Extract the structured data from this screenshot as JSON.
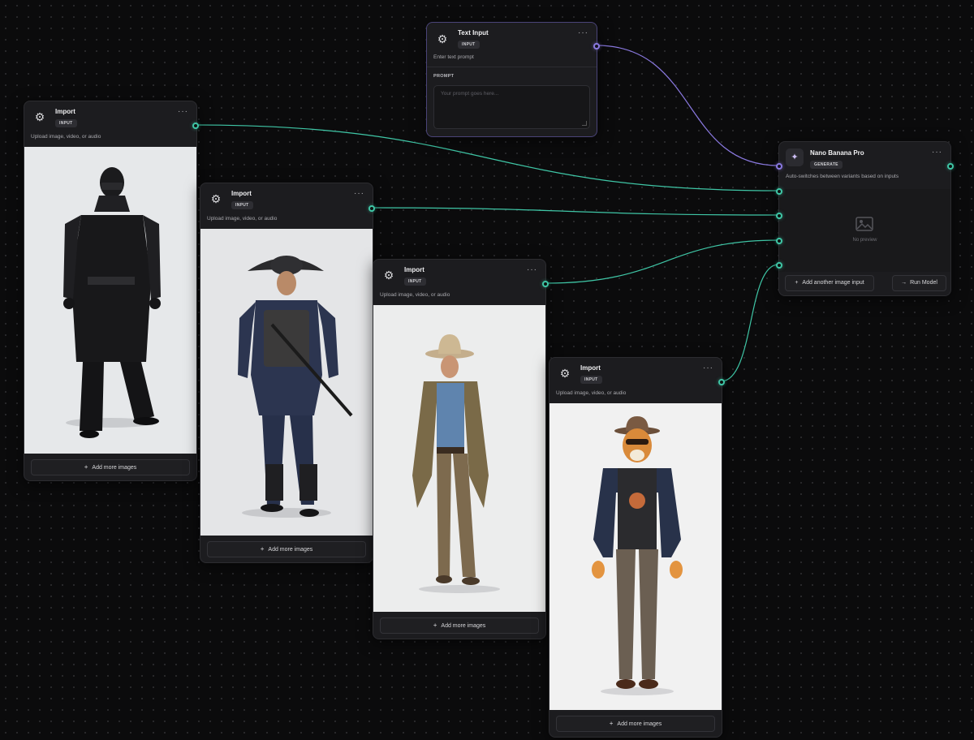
{
  "colors": {
    "canvas": "#0b0b0c",
    "node_bg": "#1c1c1f",
    "teal_wire": "#3fc6a6",
    "purple_wire": "#8a79e0"
  },
  "text_input": {
    "title": "Text Input",
    "badge": "INPUT",
    "description": "Enter text prompt",
    "section_label": "PROMPT",
    "placeholder": "Your prompt goes here...",
    "icon": "gear-icon"
  },
  "nano": {
    "title": "Nano Banana Pro",
    "badge": "GENERATE",
    "description": "Auto-switches between variants based on inputs",
    "preview_text": "No preview",
    "add_input_label": "Add another image input",
    "run_label": "Run Model",
    "icon": "sparkle-icon"
  },
  "imports": [
    {
      "title": "Import",
      "badge": "INPUT",
      "description": "Upload image, video, or audio",
      "add_more_label": "Add more images",
      "image": "ninja"
    },
    {
      "title": "Import",
      "badge": "INPUT",
      "description": "Upload image, video, or audio",
      "add_more_label": "Add more images",
      "image": "samurai"
    },
    {
      "title": "Import",
      "badge": "INPUT",
      "description": "Upload image, video, or audio",
      "add_more_label": "Add more images",
      "image": "cowboy"
    },
    {
      "title": "Import",
      "badge": "INPUT",
      "description": "Upload image, video, or audio",
      "add_more_label": "Add more images",
      "image": "tiger-man"
    }
  ],
  "menu_glyph": "···"
}
